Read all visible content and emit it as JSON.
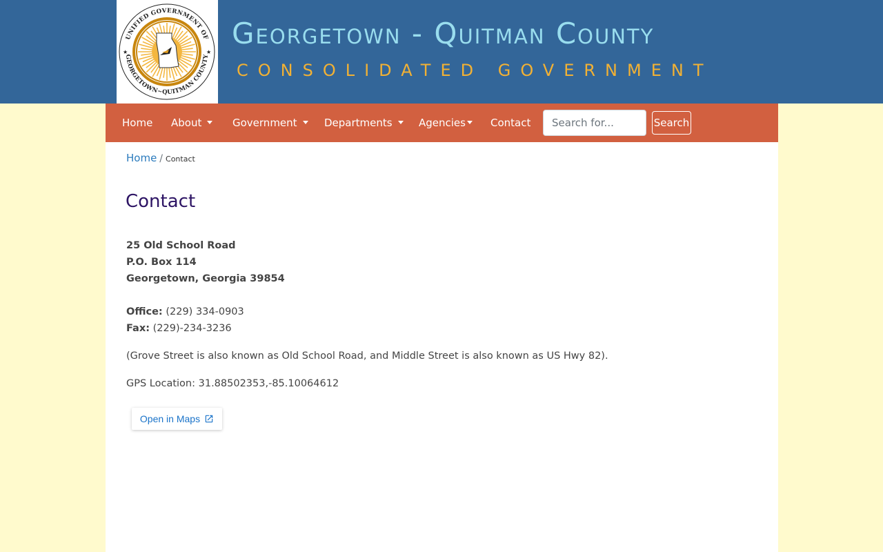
{
  "header": {
    "title": "Georgetown - Quitman County",
    "subtitle": "CONSOLIDATED GOVERNMENT",
    "seal_text_top": "UNIFIED GOVERNMENT OF",
    "seal_text_bottom": "GEORGETOWN~QUITMAN COUNTY",
    "colors": {
      "banner": "#336699",
      "title": "#99ddee",
      "subtitle": "#f2b134"
    }
  },
  "nav": {
    "items": [
      {
        "label": "Home",
        "dropdown": false
      },
      {
        "label": "About",
        "dropdown": true
      },
      {
        "label": "Government",
        "dropdown": true
      },
      {
        "label": "Departments",
        "dropdown": true
      },
      {
        "label": "Agencies",
        "dropdown": true
      },
      {
        "label": "Contact",
        "dropdown": false
      }
    ],
    "search_placeholder": "Search for...",
    "search_button": "Search",
    "color": "#d26040"
  },
  "breadcrumb": {
    "home": "Home",
    "separator": "/",
    "current": "Contact"
  },
  "page_title": "Contact",
  "address": {
    "line1": "25 Old School Road",
    "line2": "P.O. Box 114",
    "line3": "Georgetown, Georgia 39854"
  },
  "contact": {
    "office_label": "Office:",
    "office_value": " (229) 334-0903",
    "fax_label": "Fax:",
    "fax_value": " (229)-234-3236"
  },
  "note": "(Grove Street is also known as Old School Road, and Middle Street is also known as US Hwy 82).",
  "gps": "GPS Location: 31.88502353,-85.10064612",
  "maps_button": "Open in Maps",
  "background": "#fffacd"
}
